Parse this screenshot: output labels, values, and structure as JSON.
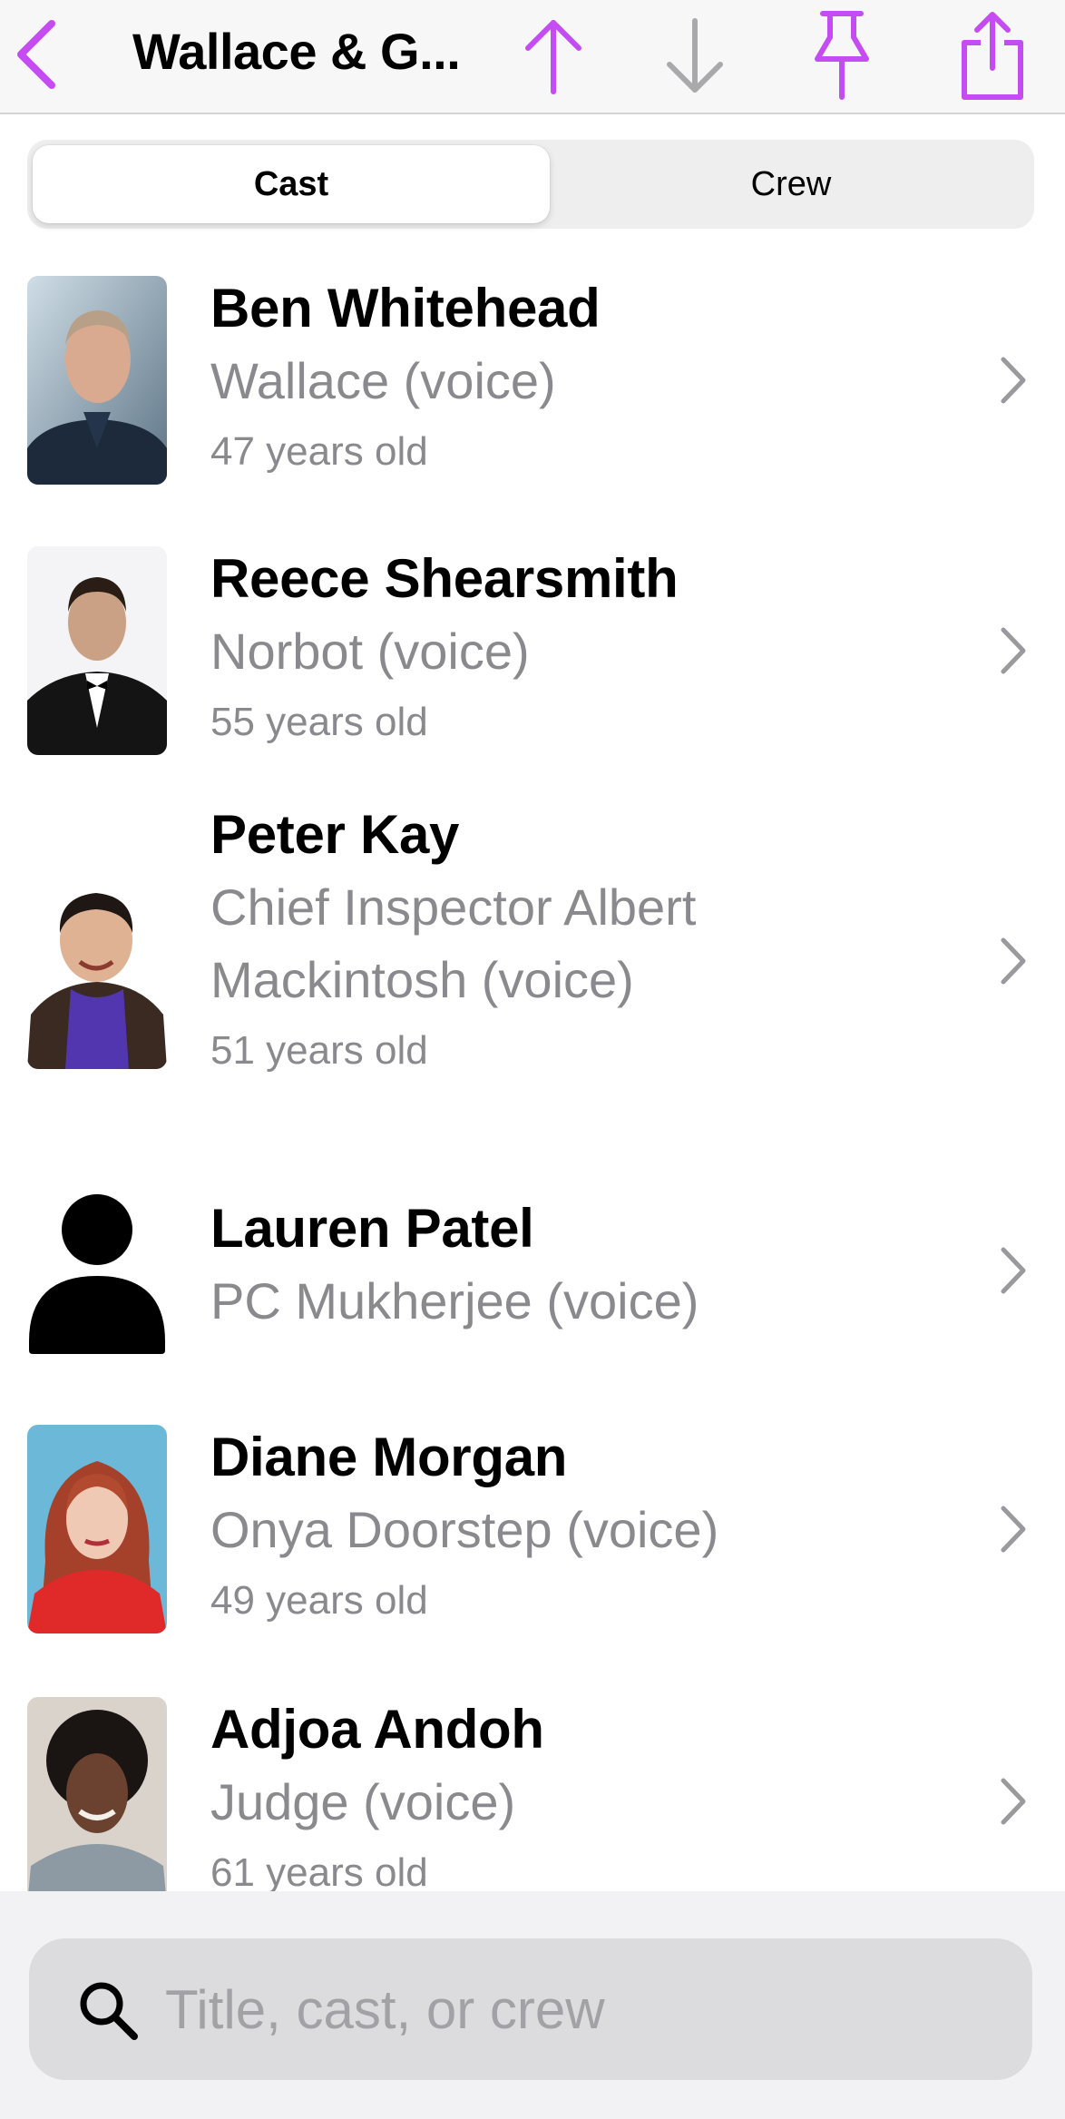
{
  "colors": {
    "accent": "#c54cf3",
    "disabled_icon": "#a9a9ab",
    "secondary_text": "#8a8a8e",
    "chevron": "#9a9a9e"
  },
  "navbar": {
    "back_icon": "chevron-left-icon",
    "title": "Wallace & G...",
    "up_icon": "arrow-up-icon",
    "down_icon": "arrow-down-icon",
    "pin_icon": "pin-icon",
    "share_icon": "share-icon"
  },
  "segmented_control": {
    "segments": [
      {
        "label": "Cast",
        "selected": true
      },
      {
        "label": "Crew",
        "selected": false
      }
    ]
  },
  "cast": [
    {
      "name": "Ben Whitehead",
      "role": "Wallace (voice)",
      "age": "47 years old",
      "photo": "headshot"
    },
    {
      "name": "Reece Shearsmith",
      "role": "Norbot (voice)",
      "age": "55 years old",
      "photo": "headshot"
    },
    {
      "name": "Peter Kay",
      "role_line1": "Chief Inspector Albert",
      "role_line2": "Mackintosh (voice)",
      "age": "51 years old",
      "photo": "headshot"
    },
    {
      "name": "Lauren Patel",
      "role": "PC Mukherjee (voice)",
      "photo": "person-placeholder-icon"
    },
    {
      "name": "Diane Morgan",
      "role": "Onya Doorstep (voice)",
      "age": "49 years old",
      "photo": "headshot"
    },
    {
      "name": "Adjoa Andoh",
      "role": "Judge (voice)",
      "age": "61 years old",
      "photo": "headshot"
    }
  ],
  "search": {
    "icon": "magnifying-glass-icon",
    "placeholder": "Title, cast, or crew",
    "value": ""
  }
}
